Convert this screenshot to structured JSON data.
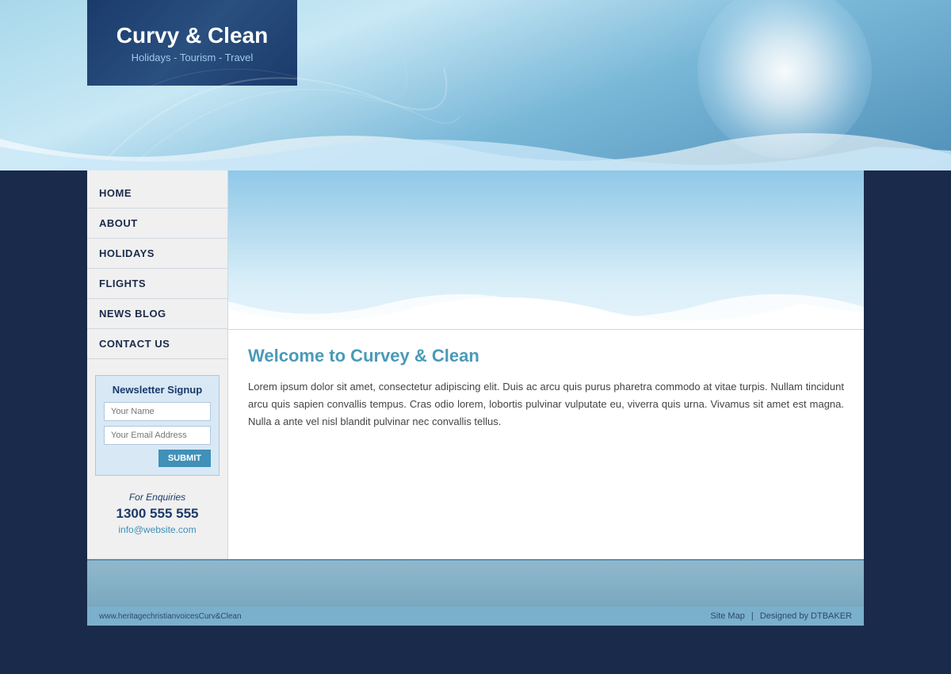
{
  "site": {
    "title": "Curvy & Clean",
    "subtitle": "Holidays - Tourism - Travel"
  },
  "header": {
    "bg_color": "#a8d8f0"
  },
  "nav": {
    "items": [
      {
        "label": "HOME",
        "id": "home"
      },
      {
        "label": "ABOUT",
        "id": "about"
      },
      {
        "label": "HOLIDAYS",
        "id": "holidays"
      },
      {
        "label": "FLIGHTS",
        "id": "flights"
      },
      {
        "label": "NEWS BLOG",
        "id": "news-blog"
      },
      {
        "label": "CONTACT US",
        "id": "contact-us"
      }
    ]
  },
  "newsletter": {
    "title": "Newsletter Signup",
    "name_placeholder": "Your Name",
    "email_placeholder": "Your Email Address",
    "submit_label": "SUBMIT"
  },
  "enquiries": {
    "label": "For Enquiries",
    "phone": "1300 555 555",
    "email": "info@website.com"
  },
  "main": {
    "welcome_title": "Welcome to Curvey & Clean",
    "welcome_text": "Lorem ipsum dolor sit amet, consectetur adipiscing elit. Duis ac arcu quis purus pharetra commodo at vitae turpis. Nullam tincidunt arcu quis sapien convallis tempus. Cras odio lorem, lobortis pulvinar vulputate eu, viverra quis urna. Vivamus sit amet est magna. Nulla a ante vel nisl blandit pulvinar nec convallis tellus."
  },
  "footer": {
    "left_text": "www.heritagechristianvoicesCurv&Clean",
    "site_map": "Site Map",
    "separator": "|",
    "designed_by": "Designed by DTBAKER"
  }
}
